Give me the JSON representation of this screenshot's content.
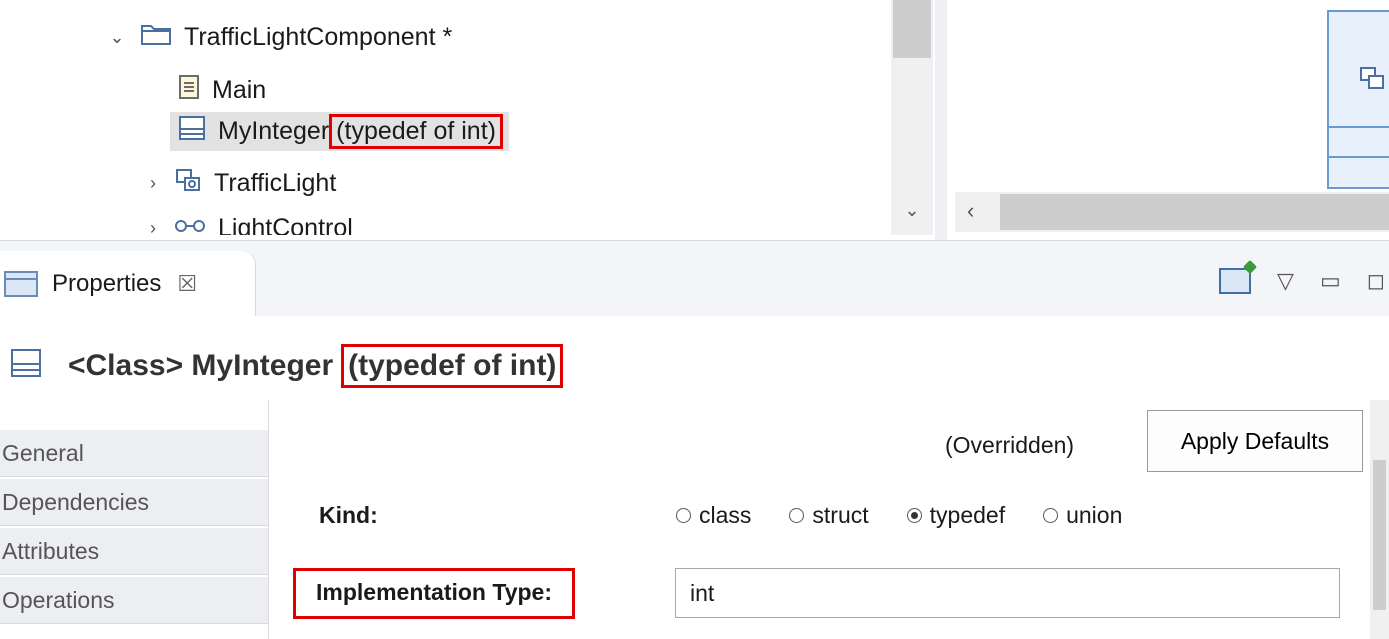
{
  "tree": {
    "items": [
      {
        "label": "TrafficLightComponent *",
        "icon": "folder-icon"
      },
      {
        "label": "Main",
        "icon": "file-icon"
      },
      {
        "label": "MyInteger",
        "suffix": "(typedef of int)",
        "icon": "class-icon"
      },
      {
        "label": "TrafficLight",
        "icon": "component-icon"
      },
      {
        "label": "LightControl",
        "icon": "interface-icon"
      }
    ]
  },
  "properties": {
    "tab_label": "Properties",
    "tab_close": "☒"
  },
  "title": {
    "prefix": "<Class> MyInteger",
    "highlight": "(typedef of int)"
  },
  "nav": {
    "items": [
      "General",
      "Dependencies",
      "Attributes",
      "Operations"
    ]
  },
  "form": {
    "overridden_label": "(Overridden)",
    "apply_defaults_label": "Apply Defaults",
    "kind_label": "Kind:",
    "kind_options": [
      "class",
      "struct",
      "typedef",
      "union"
    ],
    "kind_selected": "typedef",
    "impl_type_label": "Implementation Type:",
    "impl_type_value": "int"
  }
}
